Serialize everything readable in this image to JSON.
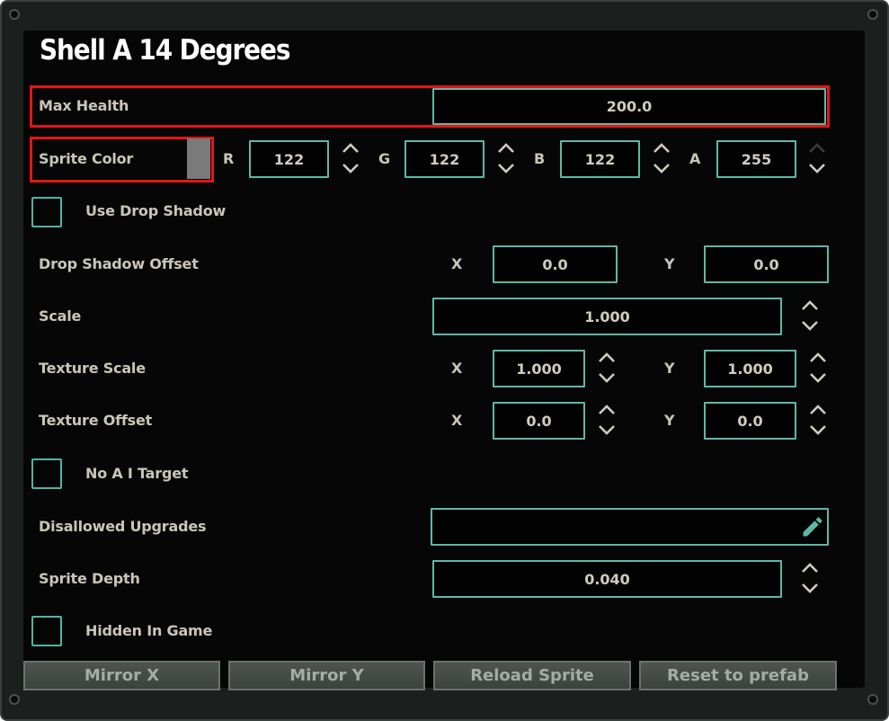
{
  "title": "Shell A 14 Degrees",
  "max_health": {
    "label": "Max Health",
    "value": "200.0"
  },
  "sprite_color": {
    "label": "Sprite Color",
    "swatch": "#7a7a7a",
    "r_label": "R",
    "r": "122",
    "g_label": "G",
    "g": "122",
    "b_label": "B",
    "b": "122",
    "a_label": "A",
    "a": "255"
  },
  "use_drop_shadow": {
    "label": "Use Drop Shadow",
    "checked": false
  },
  "drop_shadow_offset": {
    "label": "Drop Shadow Offset",
    "x_label": "X",
    "x": "0.0",
    "y_label": "Y",
    "y": "0.0"
  },
  "scale": {
    "label": "Scale",
    "value": "1.000"
  },
  "texture_scale": {
    "label": "Texture Scale",
    "x_label": "X",
    "x": "1.000",
    "y_label": "Y",
    "y": "1.000"
  },
  "texture_offset": {
    "label": "Texture Offset",
    "x_label": "X",
    "x": "0.0",
    "y_label": "Y",
    "y": "0.0"
  },
  "no_ai_target": {
    "label": "No A I Target",
    "checked": false
  },
  "disallowed_upgrades": {
    "label": "Disallowed Upgrades",
    "value": ""
  },
  "sprite_depth": {
    "label": "Sprite Depth",
    "value": "0.040"
  },
  "hidden_in_game": {
    "label": "Hidden In Game",
    "checked": false
  },
  "buttons": {
    "mirror_x": "Mirror X",
    "mirror_y": "Mirror Y",
    "reload_sprite": "Reload Sprite",
    "reset_to_prefab": "Reset to prefab"
  },
  "colors": {
    "accent": "#5fb8a6",
    "highlight": "#e3151a",
    "panel": "#060606"
  }
}
